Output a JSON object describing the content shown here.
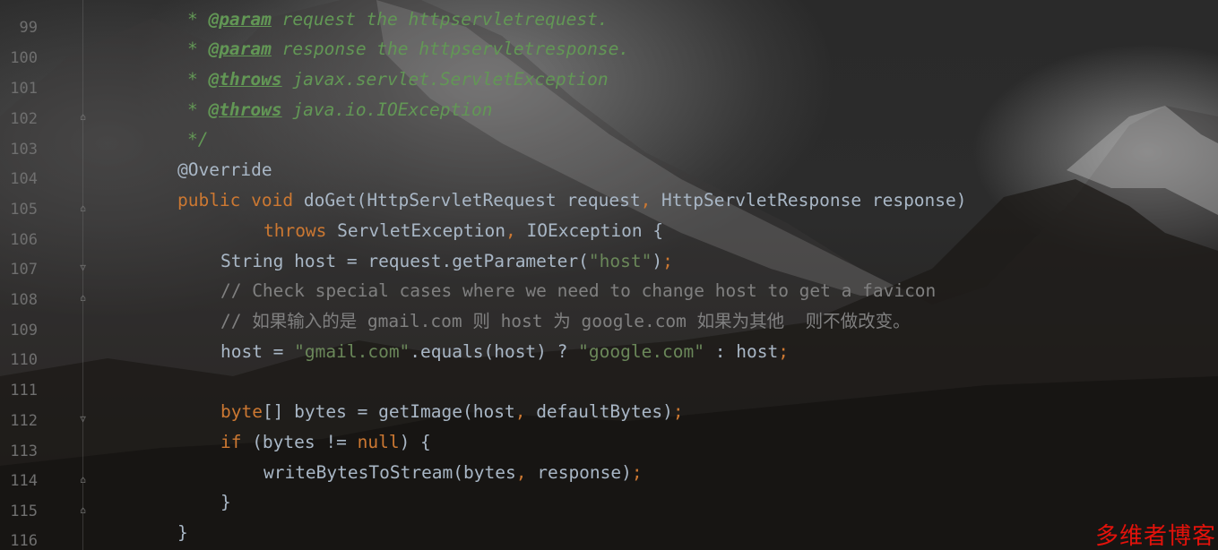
{
  "editor": {
    "line_numbers": [
      "99",
      "100",
      "101",
      "102",
      "103",
      "104",
      "105",
      "106",
      "107",
      "108",
      "109",
      "110",
      "111",
      "112",
      "113",
      "114",
      "115",
      "116"
    ],
    "top_partial": {
      "star": "* ",
      "tag": "@param",
      "rest": " request the httpservletrequest."
    },
    "l99": {
      "star": "* ",
      "tag": "@param",
      "rest": " response the httpservletresponse."
    },
    "l100": {
      "star": "* ",
      "tag": "@throws",
      "rest": " javax.servlet.ServletException"
    },
    "l101": {
      "star": "* ",
      "tag": "@throws",
      "rest": " java.io.IOException"
    },
    "l102": {
      "text": "*/"
    },
    "l103": {
      "annotation": "@Override"
    },
    "l104": {
      "kw1": "public",
      "kw2": "void",
      "name": " doGet(HttpServletRequest request",
      "comma": ",",
      "rest": " HttpServletResponse response)"
    },
    "l105": {
      "kw": "throws",
      "rest1": " ServletException",
      "comma": ",",
      "rest2": " IOException {"
    },
    "l106": {
      "a": "String host = request.getParameter(",
      "s": "\"host\"",
      "b": ")",
      "semi": ";"
    },
    "l107": {
      "comment": "// Check special cases where we need to change host to get a favicon"
    },
    "l108": {
      "comment": "// 如果输入的是 gmail.com 则 host 为 google.com 如果为其他  则不做改变。"
    },
    "l109": {
      "a": "host = ",
      "s1": "\"gmail.com\"",
      "b": ".equals(host) ? ",
      "s2": "\"google.com\"",
      "c": " : host",
      "semi": ";"
    },
    "l111": {
      "kw": "byte",
      "a": "[] bytes = getImage(host",
      "comma": ",",
      "b": " defaultBytes)",
      "semi": ";"
    },
    "l112": {
      "kw1": "if",
      "a": " (bytes != ",
      "kw2": "null",
      "b": ") {"
    },
    "l113": {
      "a": "writeBytesToStream(bytes",
      "comma": ",",
      "b": " response)",
      "semi": ";"
    },
    "l114": {
      "text": "}"
    },
    "l115": {
      "text": "}"
    }
  },
  "icons": {
    "fold": "fold-marker-icon"
  },
  "colors": {
    "keyword": "#cc7832",
    "string": "#6a8759",
    "annotation": "#bbb529",
    "comment": "#808080",
    "javadoc": "#629755",
    "watermark": "#e3120b"
  },
  "watermark": "多维者博客"
}
